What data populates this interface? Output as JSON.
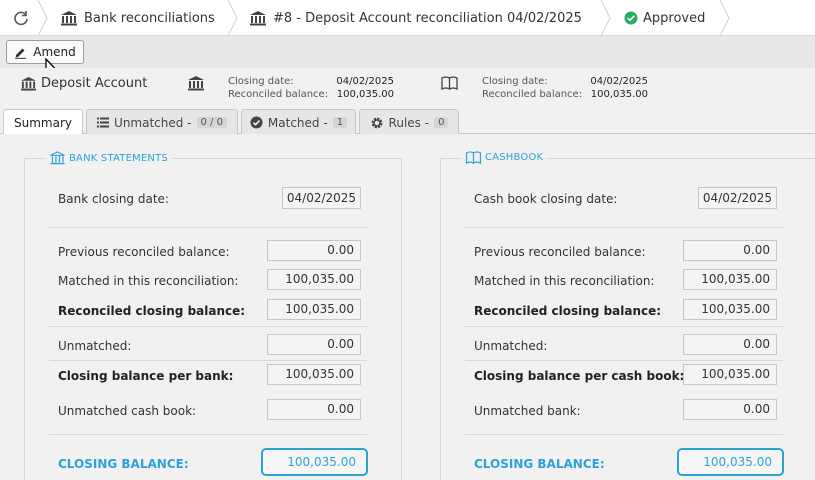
{
  "breadcrumbs": {
    "refresh_icon": "refresh-icon",
    "bank_recs_label": "Bank reconciliations",
    "current_label": "#8 - Deposit Account reconciliation 04/02/2025",
    "status_label": "Approved",
    "status_color": "#27ae60"
  },
  "toolbar": {
    "amend_label": "Amend"
  },
  "info": {
    "account_name": "Deposit Account",
    "bank": {
      "closing_date_label": "Closing date:",
      "closing_date": "04/02/2025",
      "reconciled_balance_label": "Reconciled balance:",
      "reconciled_balance": "100,035.00"
    },
    "cashbook": {
      "closing_date_label": "Closing date:",
      "closing_date": "04/02/2025",
      "reconciled_balance_label": "Reconciled balance:",
      "reconciled_balance": "100,035.00"
    }
  },
  "tabs": [
    {
      "label": "Summary"
    },
    {
      "label": "Unmatched -",
      "count": "0 / 0"
    },
    {
      "label": "Matched -",
      "count": "1"
    },
    {
      "label": "Rules -",
      "count": "0"
    }
  ],
  "bank_panel": {
    "title": "BANK STATEMENTS",
    "closing_date_label": "Bank closing date:",
    "closing_date": "04/02/2025",
    "rows": [
      {
        "label": "Previous reconciled balance:",
        "value": "0.00"
      },
      {
        "label": "Matched in this reconciliation:",
        "value": "100,035.00"
      },
      {
        "label": "Reconciled closing balance:",
        "value": "100,035.00"
      },
      {
        "label": "Unmatched:",
        "value": "0.00"
      },
      {
        "label": "Closing balance per bank:",
        "value": "100,035.00"
      },
      {
        "label": "Unmatched cash book:",
        "value": "0.00"
      }
    ],
    "closing_label": "CLOSING BALANCE:",
    "closing_value": "100,035.00"
  },
  "cash_panel": {
    "title": "CASHBOOK",
    "closing_date_label": "Cash book closing date:",
    "closing_date": "04/02/2025",
    "rows": [
      {
        "label": "Previous reconciled balance:",
        "value": "0.00"
      },
      {
        "label": "Matched in this reconciliation:",
        "value": "100,035.00"
      },
      {
        "label": "Reconciled closing balance:",
        "value": "100,035.00"
      },
      {
        "label": "Unmatched:",
        "value": "0.00"
      },
      {
        "label": "Closing balance per cash book:",
        "value": "100,035.00"
      },
      {
        "label": "Unmatched bank:",
        "value": "0.00"
      }
    ],
    "closing_label": "CLOSING BALANCE:",
    "closing_value": "100,035.00"
  },
  "accent_color": "#2ba3d6"
}
